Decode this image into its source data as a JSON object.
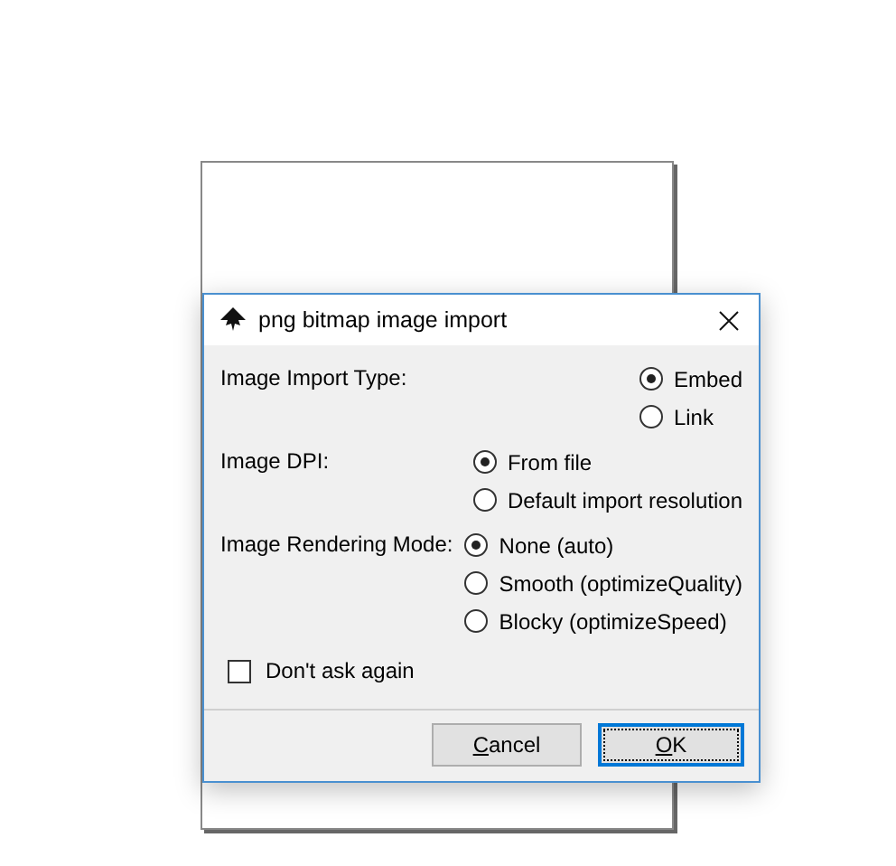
{
  "dialog": {
    "title": "png bitmap image import"
  },
  "groups": [
    {
      "label": "Image Import Type:",
      "options": [
        {
          "label": "Embed",
          "selected": true
        },
        {
          "label": "Link",
          "selected": false
        }
      ]
    },
    {
      "label": "Image DPI:",
      "options": [
        {
          "label": "From file",
          "selected": true
        },
        {
          "label": "Default import resolution",
          "selected": false
        }
      ]
    },
    {
      "label": "Image Rendering Mode:",
      "options": [
        {
          "label": "None (auto)",
          "selected": true
        },
        {
          "label": "Smooth (optimizeQuality)",
          "selected": false
        },
        {
          "label": "Blocky (optimizeSpeed)",
          "selected": false
        }
      ]
    }
  ],
  "dont_ask": {
    "label": "Don't ask again",
    "checked": false
  },
  "buttons": [
    {
      "label": "Cancel",
      "first_letter_underlined": true,
      "default": false
    },
    {
      "label": "OK",
      "first_letter_underlined": true,
      "default": true
    }
  ]
}
